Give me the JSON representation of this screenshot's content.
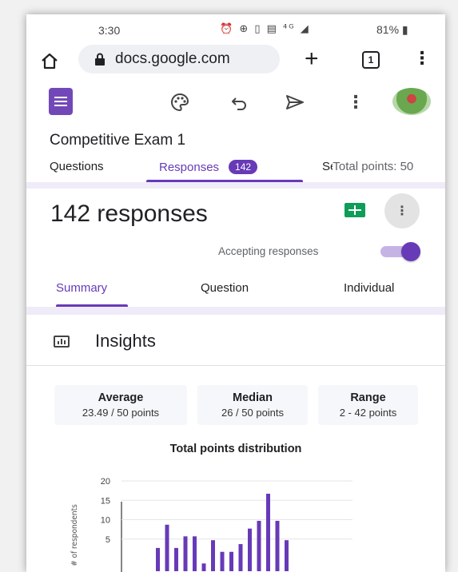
{
  "status_bar": {
    "time": "3:30",
    "icons": [
      "alarm-icon",
      "sync-icon",
      "vibrate-icon",
      "volte-icon",
      "4g-signal-icon",
      "signal-icon"
    ],
    "icons_text": "⏰ ⊕ ▯ ▤ ⁴ᴳ ◢",
    "battery": "81%"
  },
  "browser": {
    "url": "docs.google.com",
    "tab_count": "1"
  },
  "form": {
    "title": "Competitive Exam 1",
    "tabs": {
      "questions": "Questions",
      "responses": "Responses",
      "responses_count": "142",
      "settings_partial": "Se",
      "total_points": "Total points: 50"
    }
  },
  "responses": {
    "count_label": "142 responses",
    "accepting_label": "Accepting responses",
    "accepting": true
  },
  "sub_tabs": {
    "summary": "Summary",
    "question": "Question",
    "individual": "Individual"
  },
  "insights": {
    "title": "Insights",
    "stats": [
      {
        "label": "Average",
        "value": "23.49 / 50 points"
      },
      {
        "label": "Median",
        "value": "26 / 50 points"
      },
      {
        "label": "Range",
        "value": "2 - 42 points"
      }
    ]
  },
  "colors": {
    "accent": "#673ab7",
    "sheets_green": "#0f9d58"
  },
  "chart_data": {
    "type": "bar",
    "title": "Total points distribution",
    "ylabel": "# of respondents",
    "xlabel": "",
    "ylim": [
      0,
      20
    ],
    "y_ticks": [
      5,
      10,
      15,
      20
    ],
    "values": [
      6,
      12,
      6,
      9,
      9,
      2,
      8,
      5,
      5,
      7,
      11,
      13,
      20,
      13,
      8
    ]
  }
}
